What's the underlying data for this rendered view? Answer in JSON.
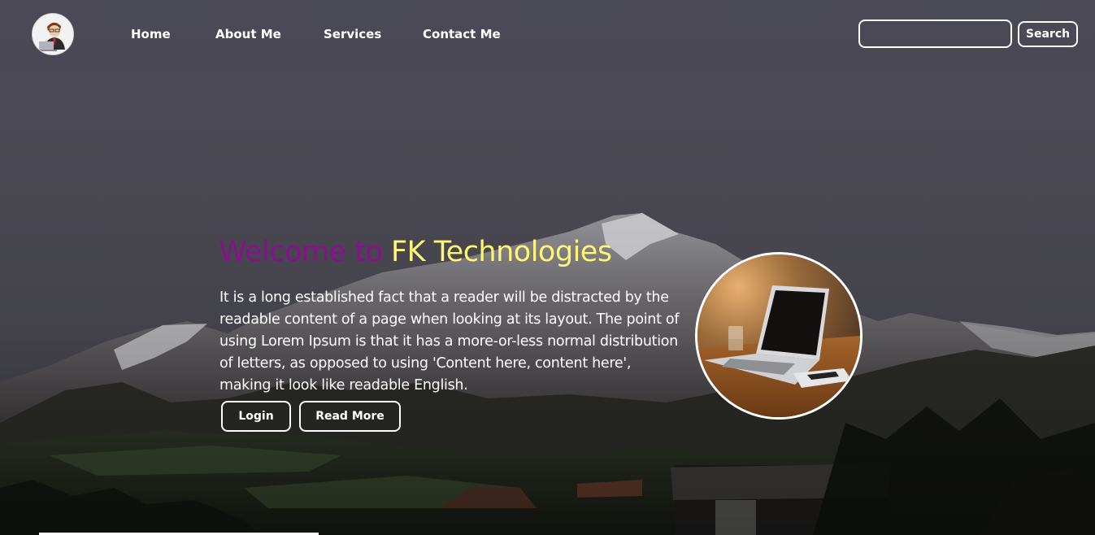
{
  "nav": {
    "links": [
      "Home",
      "About Me",
      "Services",
      "Contact Me"
    ],
    "search_placeholder": "",
    "search_value": "",
    "search_button": "Search"
  },
  "hero": {
    "title_part1": "Welcome to",
    "title_part2": "FK Technologies",
    "paragraph": "It is a long established fact that a reader will be distracted by the readable content of a page when looking at its layout. The point of using Lorem Ipsum is that it has a more-or-less normal distribution of letters, as opposed to using 'Content here, content here', making it look like readable English.",
    "login_label": "Login",
    "readmore_label": "Read More"
  },
  "colors": {
    "title_purple": "#8a0f8f",
    "title_yellow": "#fff675",
    "text": "#ffffff",
    "outline": "#ffffff"
  },
  "icons": [
    "avatar-logo",
    "laptop-photo"
  ]
}
